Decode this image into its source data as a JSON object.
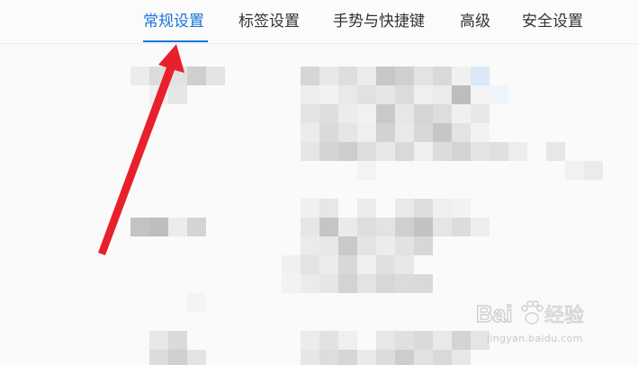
{
  "tabs": [
    {
      "label": "常规设置",
      "active": true
    },
    {
      "label": "标签设置",
      "active": false
    },
    {
      "label": "手势与快捷键",
      "active": false
    },
    {
      "label": "高级",
      "active": false
    },
    {
      "label": "安全设置",
      "active": false
    }
  ],
  "colors": {
    "accent": "#1a73d9",
    "arrow": "#e8202b",
    "text": "#333333"
  },
  "watermark": {
    "brand": "Baidu经验",
    "url": "jingyan.baidu.com"
  },
  "icons": {
    "annotation": "red-arrow-icon",
    "watermark_logo": "baidu-paw-logo-icon"
  }
}
